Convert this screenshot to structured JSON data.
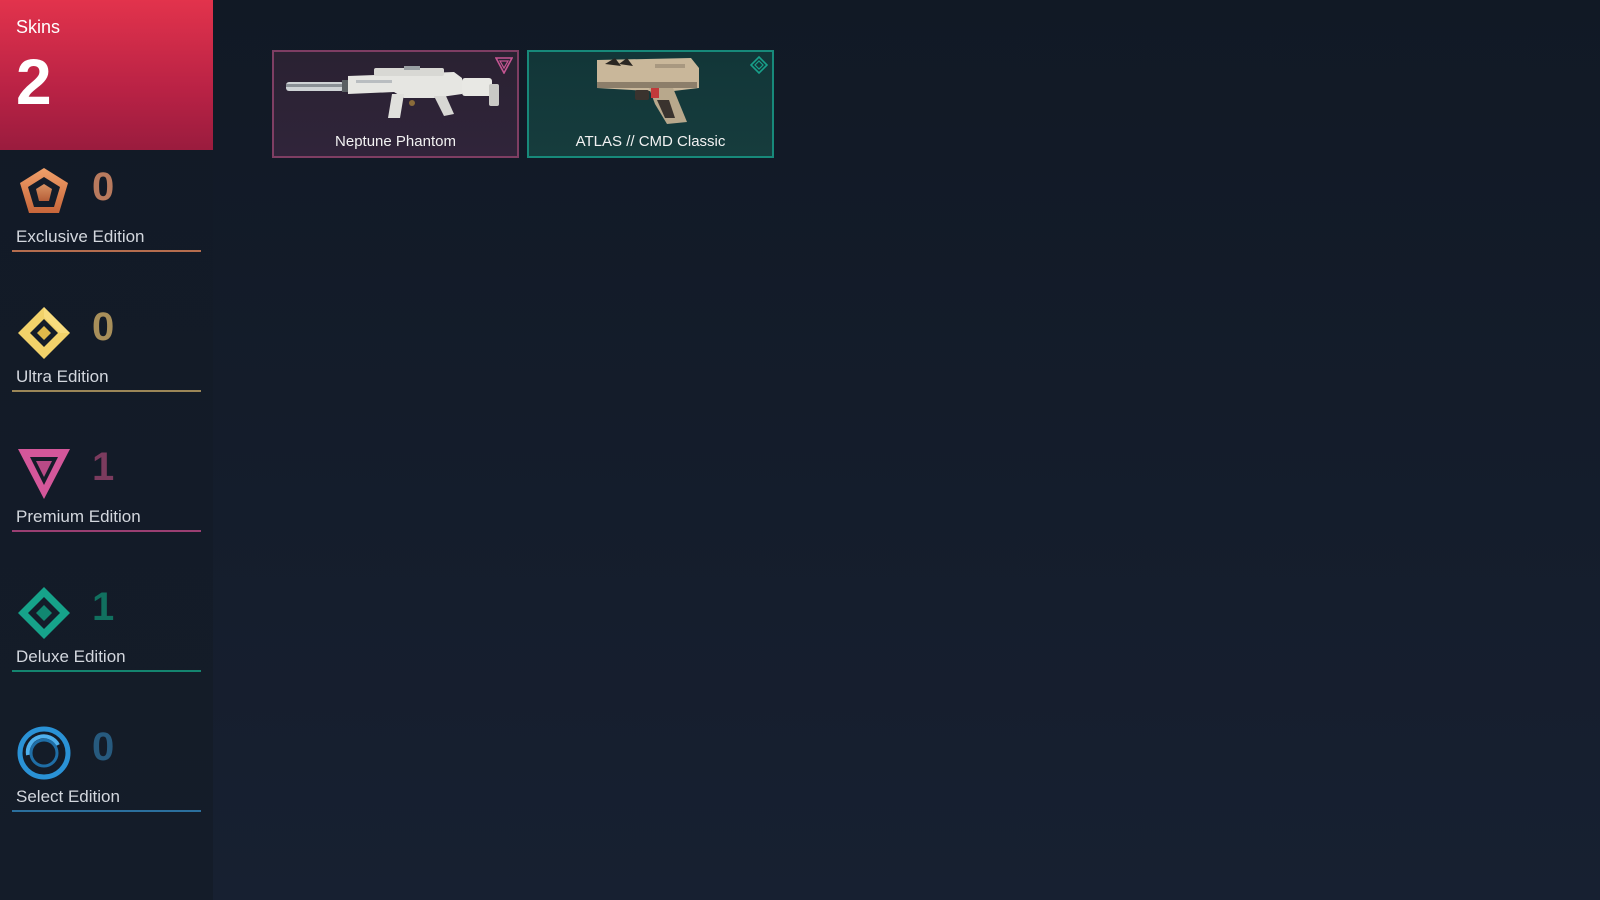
{
  "summary": {
    "label": "Skins",
    "count": "2"
  },
  "tiers": [
    {
      "label": "Exclusive Edition",
      "count": "0",
      "icon": "exclusive-edition-icon",
      "color": "#e8895a",
      "count_color": "#b87a5e"
    },
    {
      "label": "Ultra Edition",
      "count": "0",
      "icon": "ultra-edition-icon",
      "color": "#f2d26a",
      "count_color": "#a88f5a"
    },
    {
      "label": "Premium Edition",
      "count": "1",
      "icon": "premium-edition-icon",
      "color": "#d4579a",
      "count_color": "#7b3b5e"
    },
    {
      "label": "Deluxe Edition",
      "count": "1",
      "icon": "deluxe-edition-icon",
      "color": "#16a38a",
      "count_color": "#11705f"
    },
    {
      "label": "Select Edition",
      "count": "0",
      "icon": "select-edition-icon",
      "color": "#2a92d6",
      "count_color": "#275a7e"
    }
  ],
  "skins": [
    {
      "name": "Neptune Phantom",
      "tier": "premium",
      "border_color": "#7e3e63",
      "bg_color": "#2c2233",
      "icon": "premium-edition-icon"
    },
    {
      "name": "ATLAS // CMD Classic",
      "tier": "deluxe",
      "border_color": "#17897a",
      "bg_color": "#13383a",
      "icon": "deluxe-edition-icon"
    }
  ]
}
